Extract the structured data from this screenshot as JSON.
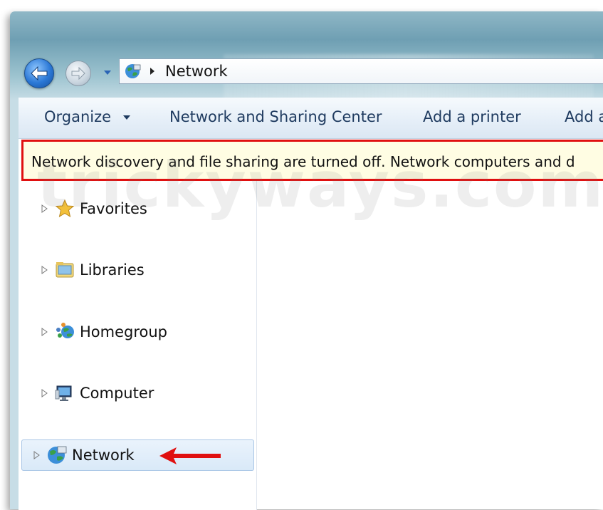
{
  "address_bar": {
    "location": "Network"
  },
  "toolbar": {
    "organize_label": "Organize",
    "network_sharing_label": "Network and Sharing Center",
    "add_printer_label": "Add a printer",
    "add_cut_label": "Add a"
  },
  "infobar": {
    "message": "Network discovery and file sharing are turned off. Network computers and d"
  },
  "sidebar": {
    "items": [
      {
        "label": "Favorites",
        "icon": "star-icon"
      },
      {
        "label": "Libraries",
        "icon": "library-icon"
      },
      {
        "label": "Homegroup",
        "icon": "homegroup-icon"
      },
      {
        "label": "Computer",
        "icon": "computer-icon"
      },
      {
        "label": "Network",
        "icon": "network-globe-icon",
        "selected": true
      }
    ]
  },
  "watermark": "trickyways.com",
  "colors": {
    "highlight_border": "#e01010",
    "selection_bg": "#d9e9f8",
    "infobar_bg": "#fffde3"
  }
}
